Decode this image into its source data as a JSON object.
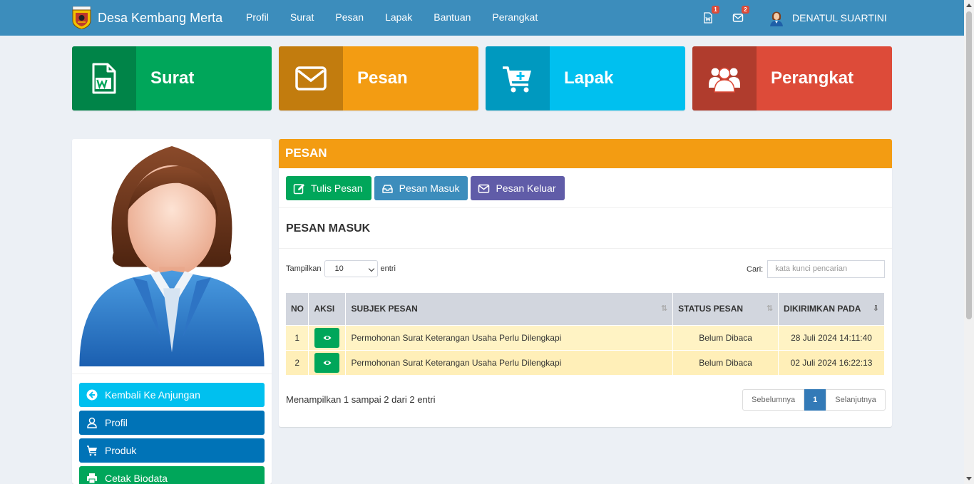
{
  "nav": {
    "brand": "Desa Kembang Merta",
    "links": [
      "Profil",
      "Surat",
      "Pesan",
      "Lapak",
      "Bantuan",
      "Perangkat"
    ],
    "surat_badge": "1",
    "pesan_badge": "2",
    "user_name": "DENATUL SUARTINI"
  },
  "tiles": [
    {
      "label": "Surat",
      "icon": "file-word-icon",
      "color": "#00a65a"
    },
    {
      "label": "Pesan",
      "icon": "envelope-icon",
      "color": "#f39c12"
    },
    {
      "label": "Lapak",
      "icon": "cart-plus-icon",
      "color": "#00c0ef"
    },
    {
      "label": "Perangkat",
      "icon": "users-icon",
      "color": "#dd4b39"
    }
  ],
  "sidebar": {
    "buttons": [
      {
        "label": "Kembali Ke Anjungan",
        "icon": "arrow-circle-left-icon",
        "color": "#00c0ef"
      },
      {
        "label": "Profil",
        "icon": "user-icon",
        "color": "#0073b7"
      },
      {
        "label": "Produk",
        "icon": "cart-plus-icon",
        "color": "#0073b7"
      },
      {
        "label": "Cetak Biodata",
        "icon": "print-icon",
        "color": "#00a65a"
      }
    ]
  },
  "panel": {
    "title": "PESAN",
    "buttons": [
      {
        "label": "Tulis Pesan",
        "icon": "edit-icon",
        "color": "#00a65a"
      },
      {
        "label": "Pesan Masuk",
        "icon": "inbox-icon",
        "color": "#3c8dbc"
      },
      {
        "label": "Pesan Keluar",
        "icon": "envelope-icon",
        "color": "#605ca8"
      }
    ],
    "subtitle": "PESAN MASUK",
    "length_label_before": "Tampilkan",
    "length_value": "10",
    "length_label_after": "entri",
    "search_label": "Cari:",
    "search_placeholder": "kata kunci pencarian",
    "columns": [
      "NO",
      "AKSI",
      "SUBJEK PESAN",
      "STATUS PESAN",
      "DIKIRIMKAN PADA"
    ],
    "rows": [
      {
        "no": "1",
        "subject": "Permohonan Surat Keterangan Usaha Perlu Dilengkapi",
        "status": "Belum Dibaca",
        "sent": "28 Juli 2024 14:11:40"
      },
      {
        "no": "2",
        "subject": "Permohonan Surat Keterangan Usaha Perlu Dilengkapi",
        "status": "Belum Dibaca",
        "sent": "02 Juli 2024 16:22:13"
      }
    ],
    "info": "Menampilkan 1 sampai 2 dari 2 entri",
    "pager": {
      "prev": "Sebelumnya",
      "page": "1",
      "next": "Selanjutnya"
    }
  }
}
